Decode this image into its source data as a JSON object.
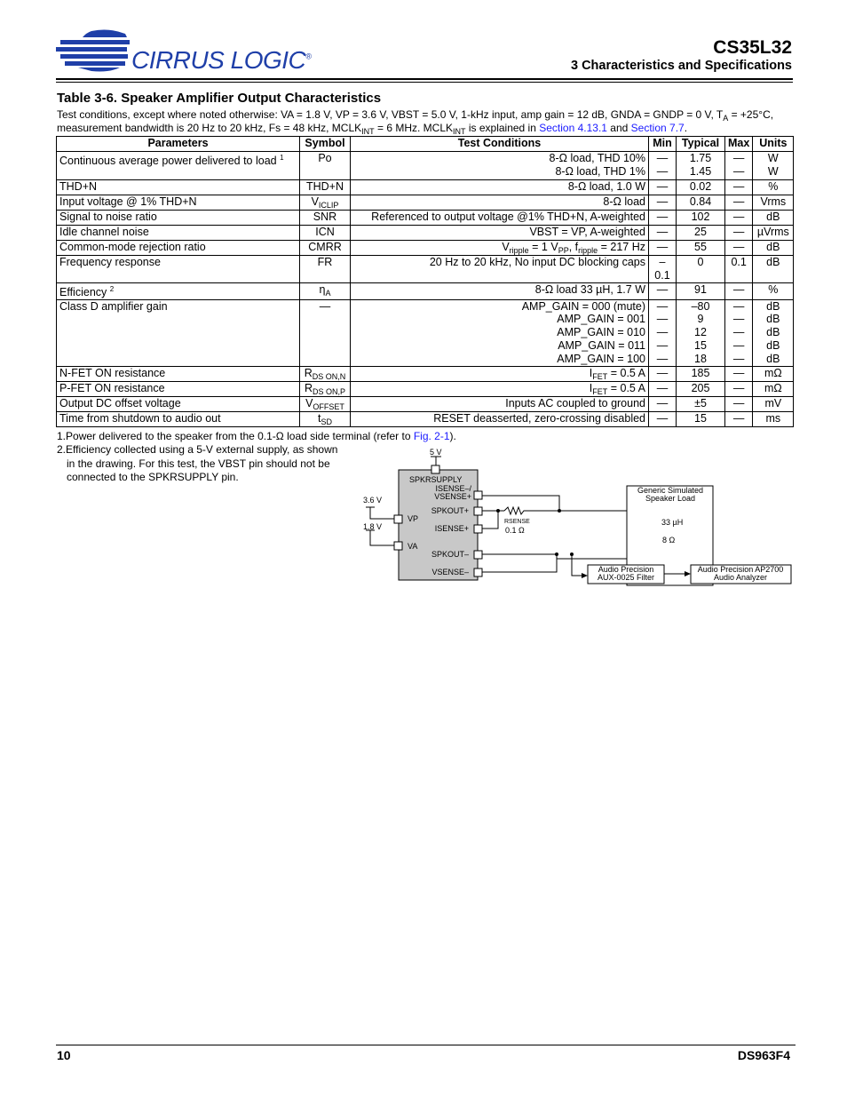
{
  "header": {
    "logo": "CIRRUS LOGIC",
    "logo_mark": "®",
    "doc_id": "CS35L32",
    "section": "3 Characteristics and Specifications"
  },
  "table_title": "Table 3-6. Speaker Amplifier Output Characteristics",
  "conditions": {
    "line1": "Test conditions, except where noted otherwise: VA = 1.8 V, VP = 3.6 V, VBST = 5.0 V, 1-kHz input, amp gain = 12 dB, GNDA = GNDP = 0 V, T",
    "line1_sub": "A",
    "line1_end": " = +25°C,",
    "line2a": "measurement bandwidth is 20 Hz to 20 kHz, Fs = 48 kHz, MCLK",
    "line2_sub": "INT",
    "line2b": " = 6 MHz. MCLK",
    "line2c": " is explained in ",
    "link1": "Section 4.13.1",
    "and": " and ",
    "link2": "Section 7.7",
    "end": "."
  },
  "columns": [
    "Parameters",
    "Symbol",
    "Test Conditions",
    "Min",
    "Typical",
    "Max",
    "Units"
  ],
  "rows": [
    {
      "param": "Continuous average power delivered to load",
      "note": "1",
      "symbol": [
        [
          "Po",
          ""
        ]
      ],
      "conds": [
        [
          [
            "8-Ω load, THD 10%",
            ""
          ]
        ],
        [
          [
            "8-Ω load, THD 1%",
            ""
          ]
        ]
      ],
      "min": [
        "—",
        "—"
      ],
      "typ": [
        "1.75",
        "1.45"
      ],
      "max": [
        "—",
        "—"
      ],
      "units": [
        "W",
        "W"
      ]
    },
    {
      "param": "THD+N",
      "symbol": [
        [
          "THD+N",
          ""
        ]
      ],
      "conds": [
        [
          [
            "8-Ω load, 1.0 W",
            ""
          ]
        ]
      ],
      "min": [
        "—"
      ],
      "typ": [
        "0.02"
      ],
      "max": [
        "—"
      ],
      "units": [
        "%"
      ]
    },
    {
      "param": "Input voltage @ 1% THD+N",
      "symbol": [
        [
          "V",
          ""
        ],
        [
          "ICLIP",
          "s"
        ]
      ],
      "conds": [
        [
          [
            "8-Ω load",
            ""
          ]
        ]
      ],
      "min": [
        "—"
      ],
      "typ": [
        "0.84"
      ],
      "max": [
        "—"
      ],
      "units": [
        "Vrms"
      ]
    },
    {
      "param": "Signal to noise ratio",
      "symbol": [
        [
          "SNR",
          ""
        ]
      ],
      "conds": [
        [
          [
            "Referenced to output voltage @1% THD+N, A-weighted",
            ""
          ]
        ]
      ],
      "min": [
        "—"
      ],
      "typ": [
        "102"
      ],
      "max": [
        "—"
      ],
      "units": [
        "dB"
      ]
    },
    {
      "param": "Idle channel noise",
      "symbol": [
        [
          "ICN",
          ""
        ]
      ],
      "conds": [
        [
          [
            "VBST = VP, A-weighted",
            ""
          ]
        ]
      ],
      "min": [
        "—"
      ],
      "typ": [
        "25"
      ],
      "max": [
        "—"
      ],
      "units": [
        "µVrms"
      ]
    },
    {
      "param": "Common-mode rejection ratio",
      "symbol": [
        [
          "CMRR",
          ""
        ]
      ],
      "conds": [
        [
          [
            "V",
            ""
          ],
          [
            "ripple",
            "s"
          ],
          [
            " = 1 V",
            ""
          ],
          [
            "PP",
            "s"
          ],
          [
            ", f",
            ""
          ],
          [
            "ripple",
            "s"
          ],
          [
            " = 217 Hz",
            ""
          ]
        ]
      ],
      "min": [
        "—"
      ],
      "typ": [
        "55"
      ],
      "max": [
        "—"
      ],
      "units": [
        "dB"
      ]
    },
    {
      "param": "Frequency response",
      "symbol": [
        [
          "FR",
          ""
        ]
      ],
      "conds": [
        [
          [
            "20 Hz to 20 kHz, No input DC blocking caps",
            ""
          ]
        ]
      ],
      "min": [
        "–0.1"
      ],
      "typ": [
        "0"
      ],
      "max": [
        "0.1"
      ],
      "units": [
        "dB"
      ]
    },
    {
      "param": "Efficiency",
      "note": "2",
      "symbol": [
        [
          "η",
          ""
        ],
        [
          "A",
          "s"
        ]
      ],
      "conds": [
        [
          [
            "8-Ω load 33 µH, 1.7 W",
            ""
          ]
        ]
      ],
      "min": [
        "—"
      ],
      "typ": [
        "91"
      ],
      "max": [
        "—"
      ],
      "units": [
        "%"
      ]
    },
    {
      "param": "Class D amplifier gain",
      "symbol": [
        [
          "—",
          ""
        ]
      ],
      "conds": [
        [
          [
            "AMP_GAIN = 000 (mute)",
            ""
          ]
        ],
        [
          [
            "AMP_GAIN = 001",
            ""
          ]
        ],
        [
          [
            "AMP_GAIN = 010",
            ""
          ]
        ],
        [
          [
            "AMP_GAIN = 011",
            ""
          ]
        ],
        [
          [
            "AMP_GAIN = 100",
            ""
          ]
        ]
      ],
      "min": [
        "—",
        "—",
        "—",
        "—",
        "—"
      ],
      "typ": [
        "–80",
        "9",
        "12",
        "15",
        "18"
      ],
      "max": [
        "—",
        "—",
        "—",
        "—",
        "—"
      ],
      "units": [
        "dB",
        "dB",
        "dB",
        "dB",
        "dB"
      ]
    },
    {
      "param": "N-FET ON resistance",
      "symbol": [
        [
          "R",
          ""
        ],
        [
          "DS ON,N",
          "s"
        ]
      ],
      "conds": [
        [
          [
            "I",
            ""
          ],
          [
            "FET",
            "s"
          ],
          [
            " = 0.5 A",
            ""
          ]
        ]
      ],
      "min": [
        "—"
      ],
      "typ": [
        "185"
      ],
      "max": [
        "—"
      ],
      "units": [
        "mΩ"
      ]
    },
    {
      "param": "P-FET ON resistance",
      "symbol": [
        [
          "R",
          ""
        ],
        [
          "DS ON,P",
          "s"
        ]
      ],
      "conds": [
        [
          [
            "I",
            ""
          ],
          [
            "FET",
            "s"
          ],
          [
            " = 0.5 A",
            ""
          ]
        ]
      ],
      "min": [
        "—"
      ],
      "typ": [
        "205"
      ],
      "max": [
        "—"
      ],
      "units": [
        "mΩ"
      ]
    },
    {
      "param": "Output DC offset voltage",
      "symbol": [
        [
          "V",
          ""
        ],
        [
          "OFFSET",
          "s"
        ]
      ],
      "conds": [
        [
          [
            "Inputs AC coupled to ground",
            ""
          ]
        ]
      ],
      "min": [
        "—"
      ],
      "typ": [
        "±5"
      ],
      "max": [
        "—"
      ],
      "units": [
        "mV"
      ]
    },
    {
      "param": "Time from shutdown to audio out",
      "symbol": [
        [
          "t",
          ""
        ],
        [
          "SD",
          "s"
        ]
      ],
      "conds": [
        [
          [
            "RESET",
            "o"
          ],
          [
            " deasserted, zero-crossing disabled",
            ""
          ]
        ]
      ],
      "min": [
        "—"
      ],
      "typ": [
        "15"
      ],
      "max": [
        "—"
      ],
      "units": [
        "ms"
      ]
    }
  ],
  "footnotes": {
    "n1_num": "1.",
    "n1a": "Power delivered to the speaker from the 0.1-Ω load side terminal (refer to ",
    "n1_link": "Fig. 2-1",
    "n1b": ").",
    "n2_num": "2.",
    "n2_l1": "Efficiency collected using a 5-V external supply, as shown",
    "n2_l2": "in the drawing. For this test, the VBST pin should not be",
    "n2_l3": "connected to the SPKRSUPPLY pin."
  },
  "diagram": {
    "v5": "5 V",
    "v36": "3.6 V",
    "v18": "1.8 V",
    "spkrsupply": "SPKRSUPPLY",
    "isense_minus": "ISENSE–/",
    "vsense_plus": "VSENSE+",
    "spkout_plus": "SPKOUT+",
    "isense_plus": "ISENSE+",
    "spkout_minus": "SPKOUT–",
    "vsense_minus": "VSENSE–",
    "vp": "VP",
    "va": "VA",
    "rsense": "RSENSE",
    "rsense_val": "0.1 Ω",
    "load_l1": "Generic Simulated",
    "load_l2": "Speaker Load",
    "inductor": "33 µH",
    "resistor": "8 Ω",
    "filter_l1": "Audio Precision",
    "filter_l2": "AUX-0025 Filter",
    "analyzer_l1": "Audio Precision AP2700",
    "analyzer_l2": "Audio Analyzer",
    "chip_color": "#c8c8c8"
  },
  "footer": {
    "page": "10",
    "doc": "DS963F4"
  },
  "colors": {
    "link": "#1a1aff",
    "logo": "#1f3fa8"
  }
}
